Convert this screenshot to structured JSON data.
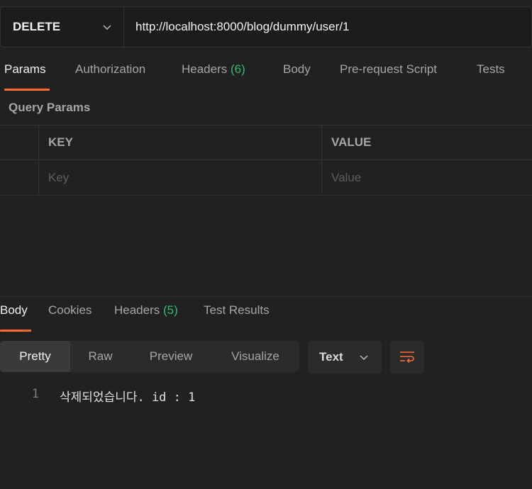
{
  "request": {
    "method": "DELETE",
    "url": "http://localhost:8000/blog/dummy/user/1"
  },
  "request_tabs": {
    "params": "Params",
    "authorization": "Authorization",
    "headers": "Headers",
    "headers_count": "(6)",
    "body": "Body",
    "pre_request_script": "Pre-request Script",
    "tests": "Tests"
  },
  "query_params": {
    "title": "Query Params",
    "columns": [
      "KEY",
      "VALUE"
    ],
    "placeholder_key": "Key",
    "placeholder_value": "Value"
  },
  "response_tabs": {
    "body": "Body",
    "cookies": "Cookies",
    "headers": "Headers",
    "headers_count": "(5)",
    "test_results": "Test Results"
  },
  "view_modes": [
    "Pretty",
    "Raw",
    "Preview",
    "Visualize"
  ],
  "format": "Text",
  "response_body": {
    "lines": [
      {
        "number": "1",
        "content": "삭제되었습니다. id : 1"
      }
    ]
  },
  "colors": {
    "accent": "#ff6c37",
    "count": "#2fbf71",
    "background": "#212121"
  },
  "icons": [
    "chevron-down-icon",
    "wrap-lines-icon"
  ]
}
